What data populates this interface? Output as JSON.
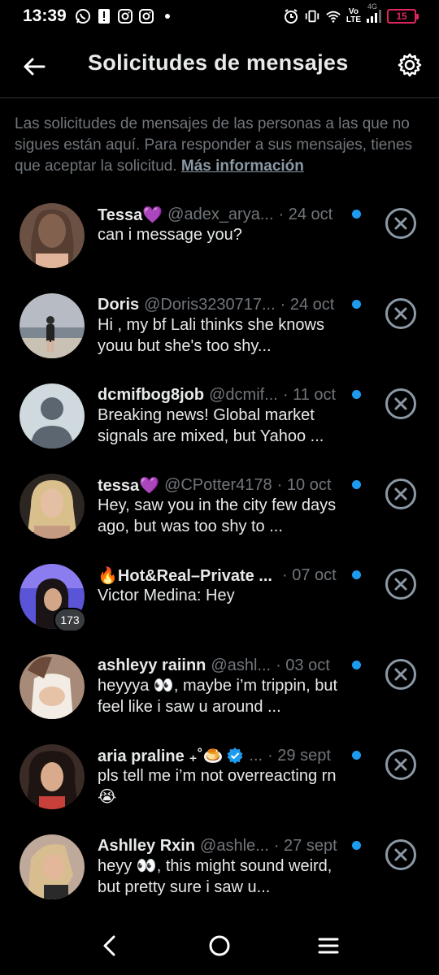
{
  "status_bar": {
    "time": "13:39",
    "left_icons": [
      "whatsapp-icon",
      "alert-icon",
      "instagram-icon",
      "instagram-icon"
    ],
    "net_top": "Vo",
    "net_bottom": "LTE",
    "net_type": "4G",
    "battery": "15"
  },
  "header": {
    "title": "Solicitudes de mensajes",
    "back_icon": "arrow-left-icon",
    "settings_icon": "gear-icon"
  },
  "info": {
    "text": "Las solicitudes de mensajes de las personas a las que no sigues están aquí. Para responder a sus mensajes, tienes que aceptar la solicitud.",
    "link": "Más información"
  },
  "requests": [
    {
      "name": "Tessa💜",
      "handle": "@adex_arya...",
      "date": "· 24 oct",
      "message": "can i message you?",
      "unread": true
    },
    {
      "name": "Doris",
      "handle": "@Doris3230717...",
      "date": "· 24 oct",
      "message": "Hi , my bf Lali  thinks she knows youu but she's too shy...",
      "unread": true
    },
    {
      "name": "dcmifbog8job",
      "handle": "@dcmif...",
      "date": "· 11 oct",
      "message": "Breaking news! Global market signals are mixed, but Yahoo ...",
      "unread": true
    },
    {
      "name": "tessa💜",
      "handle": "@CPotter4178",
      "date": "· 10 oct",
      "message": "Hey, saw you in the city few days ago, but was too shy to ...",
      "unread": true
    },
    {
      "name": "🔥Hot&Real–Private ...",
      "handle": "",
      "date": "· 07 oct",
      "message": "Victor Medina: Hey",
      "badge": "173",
      "unread": true
    },
    {
      "name": "ashleyy raiinn",
      "handle": "@ashl...",
      "date": "· 03 oct",
      "message": "heyyya 👀, maybe i’m trippin, but feel like i saw u around ...",
      "unread": true
    },
    {
      "name": "aria praline ₊˚🍮",
      "handle": "...",
      "date": "· 29 sept",
      "message": "pls tell me i’m not overreacting rn 😭",
      "verified": true,
      "unread": true
    },
    {
      "name": "Ashlley Rxin",
      "handle": "@ashle...",
      "date": "· 27 sept",
      "message": "heyy 👀, this might sound weird, but pretty sure i saw u...",
      "unread": true
    }
  ],
  "nav": {
    "back_icon": "nav-back-icon",
    "home_icon": "nav-home-icon",
    "menu_icon": "nav-menu-icon"
  },
  "colors": {
    "background": "#000000",
    "accent": "#1d9bf0",
    "secondary_text": "#71767b",
    "primary_text": "#e7e9ea",
    "battery_low": "#e0245e"
  }
}
